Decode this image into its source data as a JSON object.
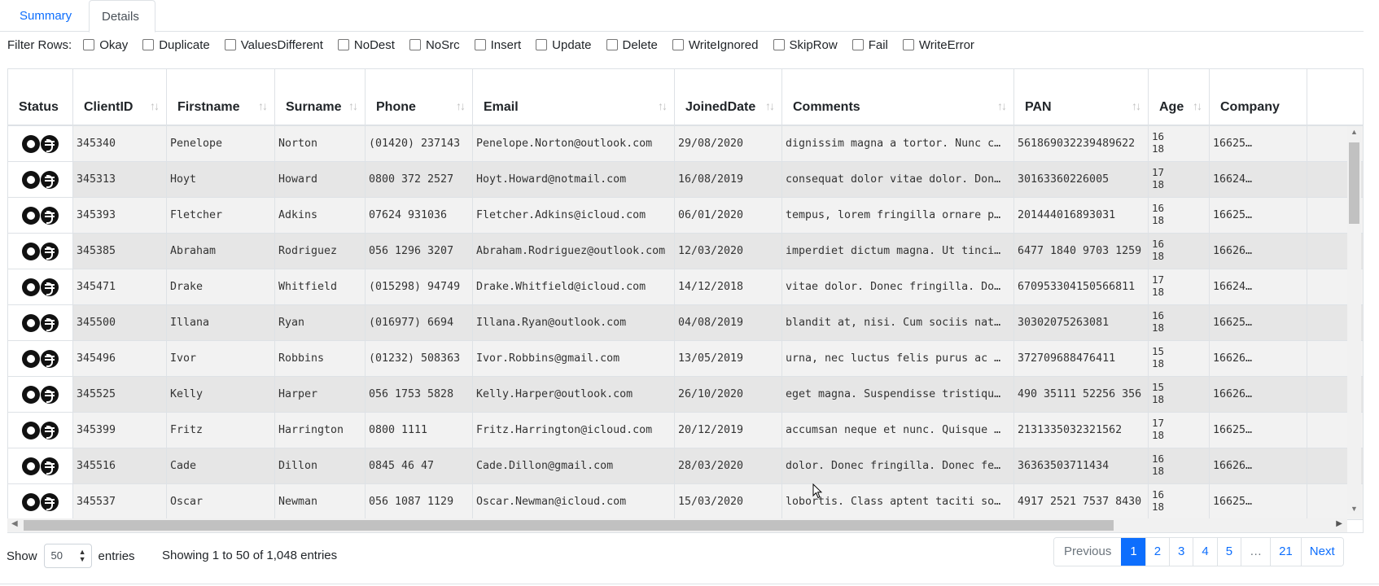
{
  "tabs": [
    {
      "label": "Summary"
    },
    {
      "label": "Details"
    }
  ],
  "filters": {
    "label": "Filter Rows:",
    "options": [
      "Okay",
      "Duplicate",
      "ValuesDifferent",
      "NoDest",
      "NoSrc",
      "Insert",
      "Update",
      "Delete",
      "WriteIgnored",
      "SkipRow",
      "Fail",
      "WriteError"
    ]
  },
  "table": {
    "columns": [
      "Status",
      "ClientID",
      "Firstname",
      "Surname",
      "Phone",
      "Email",
      "JoinedDate",
      "Comments",
      "PAN",
      "Age",
      "Company"
    ],
    "rows": [
      {
        "status": "ok-update-icon",
        "ClientID": "345340",
        "Firstname": "Penelope",
        "Surname": "Norton",
        "Phone": "(01420) 237143",
        "Email": "Penelope.Norton@outlook.com",
        "JoinedDate": "29/08/2020",
        "Comments": "dignissim magna a tortor. Nunc c…",
        "PAN": "561869032239489622",
        "Age1": "16",
        "Age2": "18",
        "Company": "16625…"
      },
      {
        "status": "ok-update-icon",
        "ClientID": "345313",
        "Firstname": "Hoyt",
        "Surname": "Howard",
        "Phone": "0800 372 2527",
        "Email": "Hoyt.Howard@notmail.com",
        "JoinedDate": "16/08/2019",
        "Comments": "consequat dolor vitae dolor. Don…",
        "PAN": "30163360226005",
        "Age1": "17",
        "Age2": "18",
        "Company": "16624…"
      },
      {
        "status": "ok-update-icon",
        "ClientID": "345393",
        "Firstname": "Fletcher",
        "Surname": "Adkins",
        "Phone": "07624 931036",
        "Email": "Fletcher.Adkins@icloud.com",
        "JoinedDate": "06/01/2020",
        "Comments": "tempus, lorem fringilla ornare p…",
        "PAN": "201444016893031",
        "Age1": "16",
        "Age2": "18",
        "Company": "16625…"
      },
      {
        "status": "ok-update-icon",
        "ClientID": "345385",
        "Firstname": "Abraham",
        "Surname": "Rodriguez",
        "Phone": "056 1296 3207",
        "Email": "Abraham.Rodriguez@outlook.com",
        "JoinedDate": "12/03/2020",
        "Comments": "imperdiet dictum magna. Ut tinci…",
        "PAN": "6477 1840 9703 1259",
        "Age1": "16",
        "Age2": "18",
        "Company": "16626…"
      },
      {
        "status": "ok-update-icon",
        "ClientID": "345471",
        "Firstname": "Drake",
        "Surname": "Whitfield",
        "Phone": "(015298) 94749",
        "Email": "Drake.Whitfield@icloud.com",
        "JoinedDate": "14/12/2018",
        "Comments": "vitae dolor. Donec fringilla. Do…",
        "PAN": "670953304150566811",
        "Age1": "17",
        "Age2": "18",
        "Company": "16624…"
      },
      {
        "status": "ok-update-icon",
        "ClientID": "345500",
        "Firstname": "Illana",
        "Surname": "Ryan",
        "Phone": "(016977) 6694",
        "Email": "Illana.Ryan@outlook.com",
        "JoinedDate": "04/08/2019",
        "Comments": "blandit at, nisi. Cum sociis nat…",
        "PAN": "30302075263081",
        "Age1": "16",
        "Age2": "18",
        "Company": "16625…"
      },
      {
        "status": "ok-update-icon",
        "ClientID": "345496",
        "Firstname": "Ivor",
        "Surname": "Robbins",
        "Phone": "(01232) 508363",
        "Email": "Ivor.Robbins@gmail.com",
        "JoinedDate": "13/05/2019",
        "Comments": "urna, nec luctus felis purus ac …",
        "PAN": "372709688476411",
        "Age1": "15",
        "Age2": "18",
        "Company": "16626…"
      },
      {
        "status": "ok-update-icon",
        "ClientID": "345525",
        "Firstname": "Kelly",
        "Surname": "Harper",
        "Phone": "056 1753 5828",
        "Email": "Kelly.Harper@outlook.com",
        "JoinedDate": "26/10/2020",
        "Comments": "eget magna. Suspendisse tristiqu…",
        "PAN": "490 35111 52256 356",
        "Age1": "15",
        "Age2": "18",
        "Company": "16626…"
      },
      {
        "status": "ok-update-icon",
        "ClientID": "345399",
        "Firstname": "Fritz",
        "Surname": "Harrington",
        "Phone": "0800 1111",
        "Email": "Fritz.Harrington@icloud.com",
        "JoinedDate": "20/12/2019",
        "Comments": "accumsan neque et nunc. Quisque …",
        "PAN": "2131335032321562",
        "Age1": "17",
        "Age2": "18",
        "Company": "16625…"
      },
      {
        "status": "ok-update-icon",
        "ClientID": "345516",
        "Firstname": "Cade",
        "Surname": "Dillon",
        "Phone": "0845 46 47",
        "Email": "Cade.Dillon@gmail.com",
        "JoinedDate": "28/03/2020",
        "Comments": "dolor. Donec fringilla. Donec fe…",
        "PAN": "36363503711434",
        "Age1": "16",
        "Age2": "18",
        "Company": "16626…"
      },
      {
        "status": "ok-update-icon",
        "ClientID": "345537",
        "Firstname": "Oscar",
        "Surname": "Newman",
        "Phone": "056 1087 1129",
        "Email": "Oscar.Newman@icloud.com",
        "JoinedDate": "15/03/2020",
        "Comments": "lobortis. Class aptent taciti so…",
        "PAN": "4917 2521 7537 8430",
        "Age1": "16",
        "Age2": "18",
        "Company": "16625…"
      }
    ]
  },
  "footer": {
    "show_label": "Show",
    "page_length": "50",
    "entries_label": "entries",
    "info": "Showing 1 to 50 of 1,048 entries"
  },
  "pagination": [
    "Previous",
    "1",
    "2",
    "3",
    "4",
    "5",
    "…",
    "21",
    "Next"
  ],
  "colors": {
    "accent": "#0d6efd",
    "row_odd": "#f2f2f2",
    "row_even": "#e6e6e6"
  }
}
